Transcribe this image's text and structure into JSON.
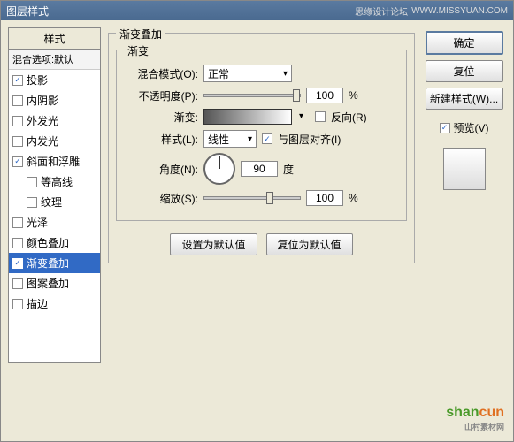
{
  "window": {
    "title": "图层样式",
    "brand": "思缘设计论坛",
    "brand_url": "WWW.MISSYUAN.COM"
  },
  "left": {
    "header": "样式",
    "subheader": "混合选项:默认",
    "items": [
      {
        "label": "投影",
        "checked": true,
        "indent": false
      },
      {
        "label": "内阴影",
        "checked": false,
        "indent": false
      },
      {
        "label": "外发光",
        "checked": false,
        "indent": false
      },
      {
        "label": "内发光",
        "checked": false,
        "indent": false
      },
      {
        "label": "斜面和浮雕",
        "checked": true,
        "indent": false
      },
      {
        "label": "等高线",
        "checked": false,
        "indent": true
      },
      {
        "label": "纹理",
        "checked": false,
        "indent": true
      },
      {
        "label": "光泽",
        "checked": false,
        "indent": false
      },
      {
        "label": "颜色叠加",
        "checked": false,
        "indent": false
      },
      {
        "label": "渐变叠加",
        "checked": true,
        "indent": false,
        "selected": true
      },
      {
        "label": "图案叠加",
        "checked": false,
        "indent": false
      },
      {
        "label": "描边",
        "checked": false,
        "indent": false
      }
    ]
  },
  "center": {
    "group_title": "渐变叠加",
    "subgroup_title": "渐变",
    "blend_mode_label": "混合模式(O):",
    "blend_mode_value": "正常",
    "opacity_label": "不透明度(P):",
    "opacity_value": "100",
    "opacity_unit": "%",
    "gradient_label": "渐变:",
    "reverse_label": "反向(R)",
    "reverse_checked": false,
    "style_label": "样式(L):",
    "style_value": "线性",
    "align_label": "与图层对齐(I)",
    "align_checked": true,
    "angle_label": "角度(N):",
    "angle_value": "90",
    "angle_unit": "度",
    "scale_label": "缩放(S):",
    "scale_value": "100",
    "scale_unit": "%",
    "btn_default": "设置为默认值",
    "btn_reset": "复位为默认值"
  },
  "right": {
    "ok": "确定",
    "cancel": "复位",
    "new_style": "新建样式(W)...",
    "preview_label": "预览(V)",
    "preview_checked": true
  },
  "watermark": {
    "text1": "shan",
    "text2": "cun",
    "sub": "山村素材网"
  }
}
